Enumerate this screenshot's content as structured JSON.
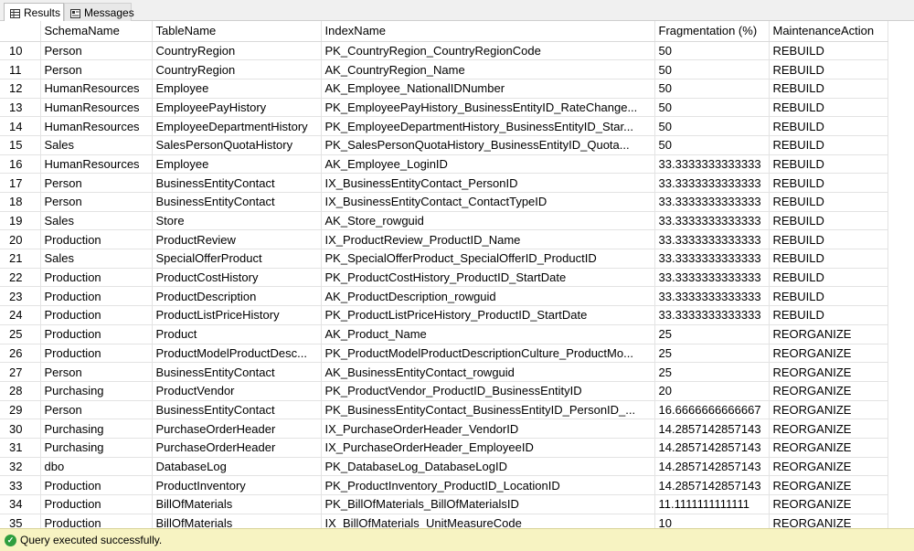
{
  "tabs": [
    {
      "label": "Results",
      "icon": "grid-icon",
      "active": true
    },
    {
      "label": "Messages",
      "icon": "messages-icon",
      "active": false
    }
  ],
  "columns": [
    "",
    "SchemaName",
    "TableName",
    "IndexName",
    "Fragmentation (%)",
    "MaintenanceAction"
  ],
  "rows": [
    [
      "10",
      "Person",
      "CountryRegion",
      "PK_CountryRegion_CountryRegionCode",
      "50",
      "REBUILD"
    ],
    [
      "11",
      "Person",
      "CountryRegion",
      "AK_CountryRegion_Name",
      "50",
      "REBUILD"
    ],
    [
      "12",
      "HumanResources",
      "Employee",
      "AK_Employee_NationalIDNumber",
      "50",
      "REBUILD"
    ],
    [
      "13",
      "HumanResources",
      "EmployeePayHistory",
      "PK_EmployeePayHistory_BusinessEntityID_RateChange...",
      "50",
      "REBUILD"
    ],
    [
      "14",
      "HumanResources",
      "EmployeeDepartmentHistory",
      "PK_EmployeeDepartmentHistory_BusinessEntityID_Star...",
      "50",
      "REBUILD"
    ],
    [
      "15",
      "Sales",
      "SalesPersonQuotaHistory",
      "PK_SalesPersonQuotaHistory_BusinessEntityID_Quota...",
      "50",
      "REBUILD"
    ],
    [
      "16",
      "HumanResources",
      "Employee",
      "AK_Employee_LoginID",
      "33.3333333333333",
      "REBUILD"
    ],
    [
      "17",
      "Person",
      "BusinessEntityContact",
      "IX_BusinessEntityContact_PersonID",
      "33.3333333333333",
      "REBUILD"
    ],
    [
      "18",
      "Person",
      "BusinessEntityContact",
      "IX_BusinessEntityContact_ContactTypeID",
      "33.3333333333333",
      "REBUILD"
    ],
    [
      "19",
      "Sales",
      "Store",
      "AK_Store_rowguid",
      "33.3333333333333",
      "REBUILD"
    ],
    [
      "20",
      "Production",
      "ProductReview",
      "IX_ProductReview_ProductID_Name",
      "33.3333333333333",
      "REBUILD"
    ],
    [
      "21",
      "Sales",
      "SpecialOfferProduct",
      "PK_SpecialOfferProduct_SpecialOfferID_ProductID",
      "33.3333333333333",
      "REBUILD"
    ],
    [
      "22",
      "Production",
      "ProductCostHistory",
      "PK_ProductCostHistory_ProductID_StartDate",
      "33.3333333333333",
      "REBUILD"
    ],
    [
      "23",
      "Production",
      "ProductDescription",
      "AK_ProductDescription_rowguid",
      "33.3333333333333",
      "REBUILD"
    ],
    [
      "24",
      "Production",
      "ProductListPriceHistory",
      "PK_ProductListPriceHistory_ProductID_StartDate",
      "33.3333333333333",
      "REBUILD"
    ],
    [
      "25",
      "Production",
      "Product",
      "AK_Product_Name",
      "25",
      "REORGANIZE"
    ],
    [
      "26",
      "Production",
      "ProductModelProductDesc...",
      "PK_ProductModelProductDescriptionCulture_ProductMo...",
      "25",
      "REORGANIZE"
    ],
    [
      "27",
      "Person",
      "BusinessEntityContact",
      "AK_BusinessEntityContact_rowguid",
      "25",
      "REORGANIZE"
    ],
    [
      "28",
      "Purchasing",
      "ProductVendor",
      "PK_ProductVendor_ProductID_BusinessEntityID",
      "20",
      "REORGANIZE"
    ],
    [
      "29",
      "Person",
      "BusinessEntityContact",
      "PK_BusinessEntityContact_BusinessEntityID_PersonID_...",
      "16.6666666666667",
      "REORGANIZE"
    ],
    [
      "30",
      "Purchasing",
      "PurchaseOrderHeader",
      "IX_PurchaseOrderHeader_VendorID",
      "14.2857142857143",
      "REORGANIZE"
    ],
    [
      "31",
      "Purchasing",
      "PurchaseOrderHeader",
      "IX_PurchaseOrderHeader_EmployeeID",
      "14.2857142857143",
      "REORGANIZE"
    ],
    [
      "32",
      "dbo",
      "DatabaseLog",
      "PK_DatabaseLog_DatabaseLogID",
      "14.2857142857143",
      "REORGANIZE"
    ],
    [
      "33",
      "Production",
      "ProductInventory",
      "PK_ProductInventory_ProductID_LocationID",
      "14.2857142857143",
      "REORGANIZE"
    ],
    [
      "34",
      "Production",
      "BillOfMaterials",
      "PK_BillOfMaterials_BillOfMaterialsID",
      "11.1111111111111",
      "REORGANIZE"
    ],
    [
      "35",
      "Production",
      "BillOfMaterials",
      "IX_BillOfMaterials_UnitMeasureCode",
      "10",
      "REORGANIZE"
    ]
  ],
  "status": {
    "icon": "success-check-icon",
    "text": "Query executed successfully.",
    "color": "#f7f3c2"
  }
}
